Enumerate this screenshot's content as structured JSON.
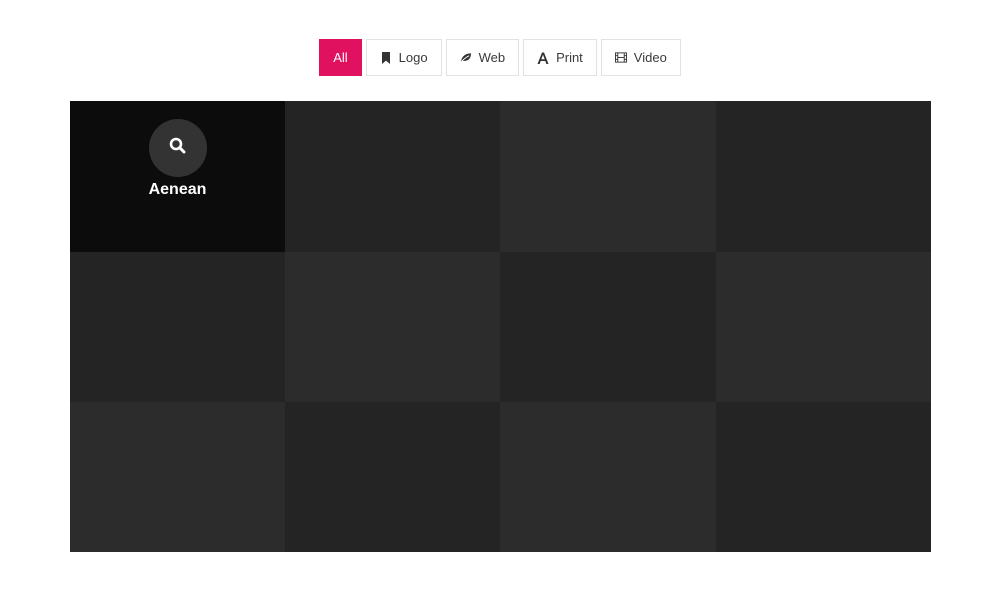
{
  "filters": [
    {
      "label": "All",
      "icon": "",
      "active": true
    },
    {
      "label": "Logo",
      "icon": "bookmark-icon",
      "active": false
    },
    {
      "label": "Web",
      "icon": "leaf-icon",
      "active": false
    },
    {
      "label": "Print",
      "icon": "font-icon",
      "active": false
    },
    {
      "label": "Video",
      "icon": "film-icon",
      "active": false
    }
  ],
  "portfolio": {
    "items": [
      {
        "color": "#0c0c0c",
        "title": "Aenean",
        "icon": "search-icon"
      },
      {
        "color": "#242424"
      },
      {
        "color": "#2c2c2c"
      },
      {
        "color": "#242424"
      },
      {
        "color": "#242424"
      },
      {
        "color": "#2c2c2c"
      },
      {
        "color": "#242424"
      },
      {
        "color": "#2c2c2c"
      },
      {
        "color": "#2c2c2c"
      },
      {
        "color": "#242424"
      },
      {
        "color": "#2c2c2c"
      },
      {
        "color": "#242424"
      }
    ]
  },
  "colors": {
    "accent": "#e0115f"
  }
}
